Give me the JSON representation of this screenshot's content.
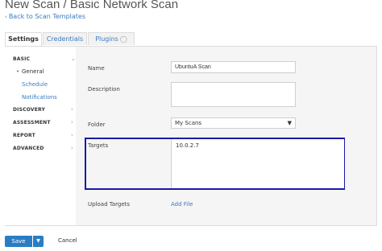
{
  "header": {
    "title": "New Scan / Basic Network Scan",
    "back_link": "Back to Scan Templates"
  },
  "tabs": [
    {
      "label": "Settings",
      "active": true
    },
    {
      "label": "Credentials",
      "active": false
    },
    {
      "label": "Plugins",
      "active": false
    }
  ],
  "sidebar": {
    "basic": "BASIC",
    "general": "General",
    "schedule": "Schedule",
    "notifications": "Notifications",
    "discovery": "DISCOVERY",
    "assessment": "ASSESSMENT",
    "report": "REPORT",
    "advanced": "ADVANCED"
  },
  "form": {
    "name_label": "Name",
    "name_value": "UbuntuA Scan",
    "description_label": "Description",
    "description_value": "",
    "folder_label": "Folder",
    "folder_value": "My Scans",
    "targets_label": "Targets",
    "targets_value": "10.0.2.7",
    "upload_targets_label": "Upload Targets",
    "add_file": "Add File"
  },
  "footer": {
    "save": "Save",
    "cancel": "Cancel"
  },
  "colors": {
    "accent": "#2a7dc4",
    "link": "#3b7bbf",
    "highlight_box": "#1a1aa8"
  }
}
